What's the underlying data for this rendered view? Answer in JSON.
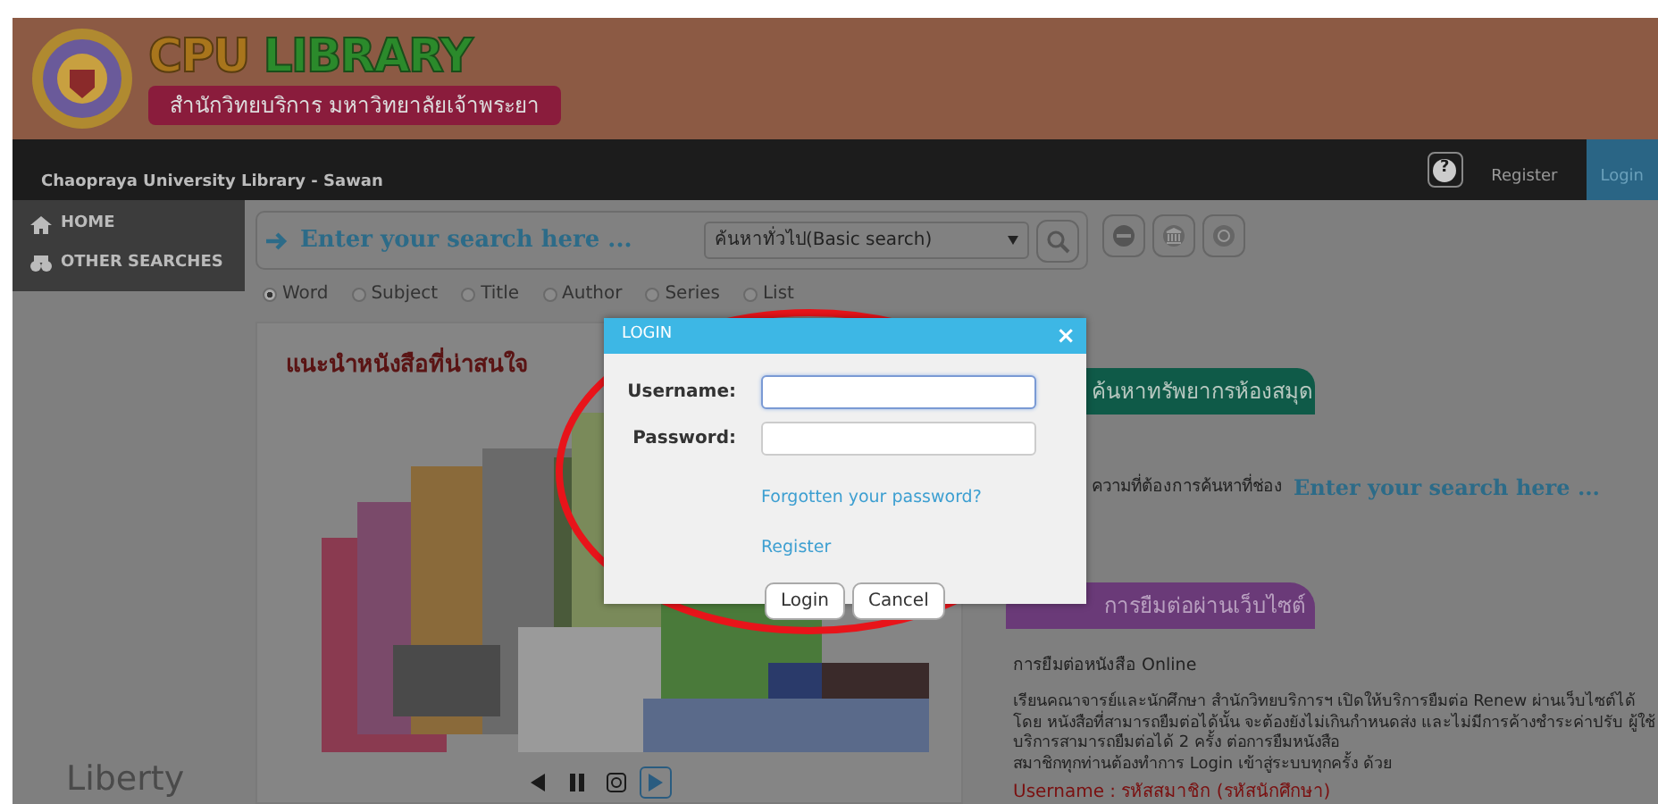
{
  "header": {
    "title_part_1": "CPU",
    "title_part_2": "LIBRARY",
    "subtitle": "สำนักวิทยบริการ มหาวิทยาลัยเจ้าพระยา"
  },
  "navbar": {
    "site_name": "Chaopraya University Library - Sawan",
    "help": "?",
    "links": [
      {
        "label": "Register",
        "selected": false
      },
      {
        "label": "Login",
        "selected": true
      }
    ]
  },
  "sidebar": {
    "items": [
      {
        "label": "HOME",
        "kind": "home"
      },
      {
        "label": "OTHER SEARCHES",
        "kind": "binoculars"
      }
    ],
    "footer_logo": "Liberty"
  },
  "search": {
    "placeholder": "Enter your search here ...",
    "mode": "ค้นหาทั่วไป(Basic search)",
    "options": [
      {
        "label": "Word",
        "selected": true
      },
      {
        "label": "Subject",
        "selected": false
      },
      {
        "label": "Title",
        "selected": false
      },
      {
        "label": "Author",
        "selected": false
      },
      {
        "label": "Series",
        "selected": false
      },
      {
        "label": "List",
        "selected": false
      }
    ]
  },
  "featured": {
    "title": "แนะนำหนังสือที่น่าสนใจ"
  },
  "info": {
    "search_tab": "ค้นหาทรัพยากรห้องสมุด",
    "search_hint": "ความที่ต้องการค้นหาที่ช่อง",
    "search_hint_example": "Enter your search here ...",
    "renew_tab": "การยืมต่อผ่านเว็บไซต์",
    "renew_title": "การยืมต่อหนังสือ Online",
    "renew_text": "เรียนคณาจารย์และนักศึกษา สำนักวิทยบริการฯ เปิดให้บริการยืมต่อ Renew ผ่านเว็บไซต์ได้โดย หนังสือที่สามารถยืมต่อได้นั้น จะต้องยังไม่เกินกำหนดส่ง และไม่มีการค้างชำระค่าปรับ ผู้ใช้บริการสามารถยืมต่อได้ 2 ครั้ง ต่อการยืมหนังสือ",
    "renew_login_note": "สมาชิกทุกท่านต้องทำการ Login เข้าสู่ระบบทุกครั้ง ด้วย",
    "renew_username_note": "Username : รหัสสมาชิก (รหัสนักศึกษา)"
  },
  "modal": {
    "title": "LOGIN",
    "close": "×",
    "fields": [
      {
        "label": "Username:",
        "focused": true
      },
      {
        "label": "Password:",
        "focused": false
      }
    ],
    "links": [
      "Forgotten your password?",
      "Register"
    ],
    "buttons": [
      "Login",
      "Cancel"
    ]
  }
}
